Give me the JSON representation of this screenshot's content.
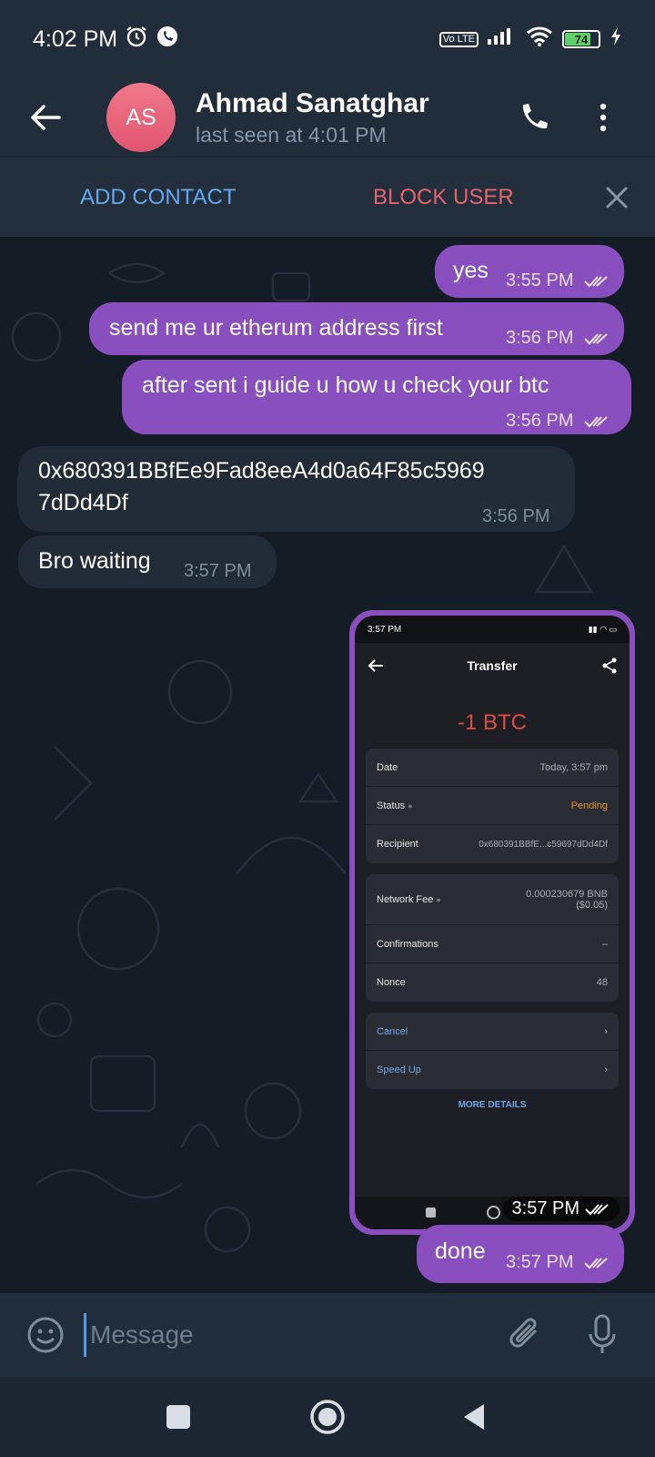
{
  "status_bar": {
    "time": "4:02 PM",
    "volte": "Vo LTE",
    "battery": "74",
    "icons": [
      "alarm-icon",
      "whatsapp-call-icon",
      "signal-icon",
      "wifi-icon",
      "battery-icon",
      "charging-icon"
    ]
  },
  "header": {
    "avatar_initials": "AS",
    "avatar_color": "#e8667c",
    "name": "Ahmad Sanatghar",
    "last_seen": "last seen at 4:01 PM"
  },
  "action_bar": {
    "add_contact": "ADD CONTACT",
    "block_user": "BLOCK USER"
  },
  "messages": [
    {
      "dir": "out",
      "text": "yes",
      "time": "3:55 PM"
    },
    {
      "dir": "out",
      "text": "send me ur etherum address first",
      "time": "3:56 PM"
    },
    {
      "dir": "out",
      "text": "after sent i guide u how u check your btc",
      "time": "3:56 PM"
    },
    {
      "dir": "in",
      "text_line1": "0x680391BBfEe9Fad8eeA4d0a64F85c5969",
      "text_line2": "7dDd4Df",
      "time": "3:56 PM"
    },
    {
      "dir": "in",
      "text": "Bro waiting",
      "time": "3:57 PM"
    },
    {
      "dir": "out",
      "type": "image",
      "time": "3:57 PM"
    },
    {
      "dir": "out",
      "text": "done",
      "time": "3:57 PM"
    }
  ],
  "screenshot": {
    "time": "3:57 PM",
    "title": "Transfer",
    "amount": "-1 BTC",
    "rows1": [
      {
        "label": "Date",
        "value": "Today, 3:57 pm"
      },
      {
        "label": "Status",
        "value": "Pending"
      },
      {
        "label": "Recipient",
        "value": "0x680391BBfE...c59697dDd4Df"
      }
    ],
    "rows2": [
      {
        "label": "Network Fee",
        "value_line1": "0.000230679 BNB",
        "value_line2": "($0.05)"
      },
      {
        "label": "Confirmations",
        "value": "–"
      },
      {
        "label": "Nonce",
        "value": "48"
      }
    ],
    "rows3": [
      {
        "label": "Cancel"
      },
      {
        "label": "Speed Up"
      }
    ],
    "more_details": "MORE DETAILS"
  },
  "input": {
    "placeholder": "Message"
  },
  "colors": {
    "outgoing_bubble": "#8a4fbf",
    "incoming_bubble": "#222c38",
    "link_blue": "#62a9f0",
    "danger_red": "#e5646a"
  }
}
